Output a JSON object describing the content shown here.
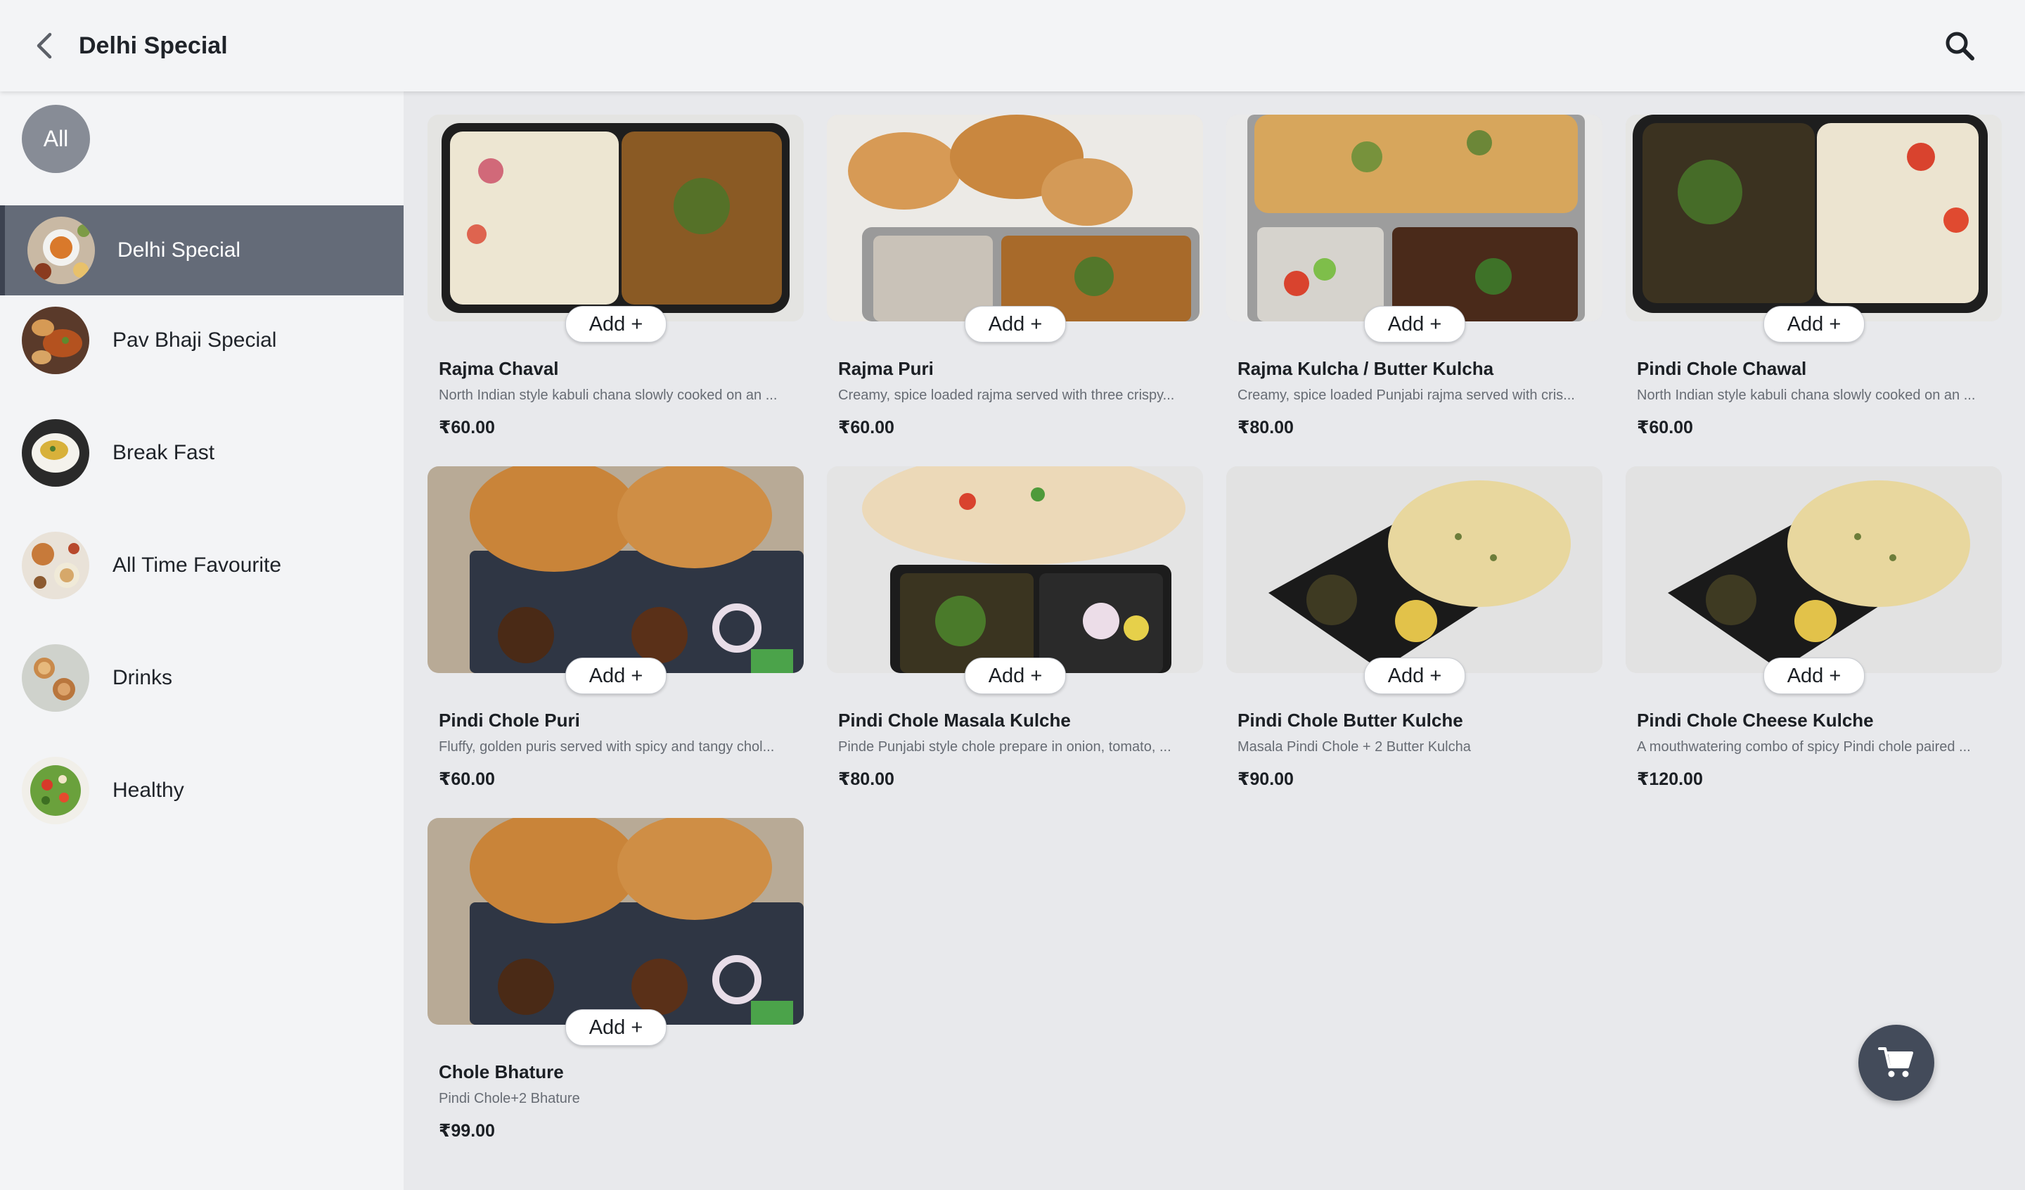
{
  "header": {
    "title": "Delhi Special",
    "back_icon": "chevron-left-icon",
    "search_icon": "search-icon"
  },
  "sidebar": {
    "all_label": "All",
    "categories": [
      {
        "label": "Delhi Special",
        "active": true
      },
      {
        "label": "Pav Bhaji Special",
        "active": false
      },
      {
        "label": "Break Fast",
        "active": false
      },
      {
        "label": "All Time Favourite",
        "active": false
      },
      {
        "label": "Drinks",
        "active": false
      },
      {
        "label": "Healthy",
        "active": false
      }
    ]
  },
  "add_label": "Add +",
  "items": [
    {
      "name": "Rajma Chaval",
      "desc": "North Indian style kabuli chana slowly cooked on an ...",
      "price": "₹60.00"
    },
    {
      "name": "Rajma Puri",
      "desc": "Creamy, spice loaded rajma served with three crispy...",
      "price": "₹60.00"
    },
    {
      "name": "Rajma Kulcha / Butter Kulcha",
      "desc": "Creamy, spice loaded Punjabi rajma served with cris...",
      "price": "₹80.00"
    },
    {
      "name": "Pindi Chole Chawal",
      "desc": "North Indian style kabuli chana slowly cooked on an ...",
      "price": "₹60.00"
    },
    {
      "name": "Pindi Chole Puri",
      "desc": "Fluffy, golden puris served with spicy and tangy chol...",
      "price": "₹60.00"
    },
    {
      "name": "Pindi Chole Masala Kulche",
      "desc": "Pinde Punjabi style chole prepare in onion, tomato, ...",
      "price": "₹80.00"
    },
    {
      "name": "Pindi Chole Butter Kulche",
      "desc": "Masala Pindi Chole + 2 Butter Kulcha",
      "price": "₹90.00"
    },
    {
      "name": "Pindi Chole Cheese Kulche",
      "desc": "A mouthwatering combo of spicy Pindi chole paired ...",
      "price": "₹120.00"
    },
    {
      "name": "Chole Bhature",
      "desc": "Pindi Chole+2 Bhature",
      "price": "₹99.00"
    }
  ],
  "cart_icon": "cart-icon",
  "colors": {
    "header_bg": "#f3f4f6",
    "sidebar_active_bg": "#646b78",
    "content_bg": "#e8e9ec",
    "fab_bg": "#434b5a"
  }
}
